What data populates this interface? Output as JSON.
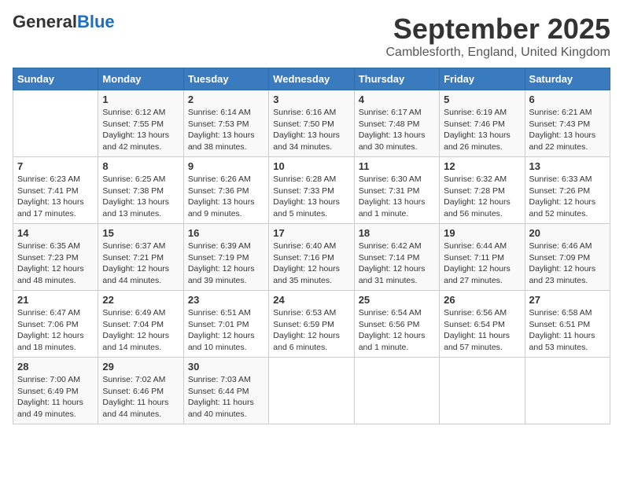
{
  "header": {
    "logo_line1": "General",
    "logo_line2": "Blue",
    "month": "September 2025",
    "location": "Camblesforth, England, United Kingdom"
  },
  "days_of_week": [
    "Sunday",
    "Monday",
    "Tuesday",
    "Wednesday",
    "Thursday",
    "Friday",
    "Saturday"
  ],
  "weeks": [
    [
      {
        "day": "",
        "info": ""
      },
      {
        "day": "1",
        "info": "Sunrise: 6:12 AM\nSunset: 7:55 PM\nDaylight: 13 hours\nand 42 minutes."
      },
      {
        "day": "2",
        "info": "Sunrise: 6:14 AM\nSunset: 7:53 PM\nDaylight: 13 hours\nand 38 minutes."
      },
      {
        "day": "3",
        "info": "Sunrise: 6:16 AM\nSunset: 7:50 PM\nDaylight: 13 hours\nand 34 minutes."
      },
      {
        "day": "4",
        "info": "Sunrise: 6:17 AM\nSunset: 7:48 PM\nDaylight: 13 hours\nand 30 minutes."
      },
      {
        "day": "5",
        "info": "Sunrise: 6:19 AM\nSunset: 7:46 PM\nDaylight: 13 hours\nand 26 minutes."
      },
      {
        "day": "6",
        "info": "Sunrise: 6:21 AM\nSunset: 7:43 PM\nDaylight: 13 hours\nand 22 minutes."
      }
    ],
    [
      {
        "day": "7",
        "info": "Sunrise: 6:23 AM\nSunset: 7:41 PM\nDaylight: 13 hours\nand 17 minutes."
      },
      {
        "day": "8",
        "info": "Sunrise: 6:25 AM\nSunset: 7:38 PM\nDaylight: 13 hours\nand 13 minutes."
      },
      {
        "day": "9",
        "info": "Sunrise: 6:26 AM\nSunset: 7:36 PM\nDaylight: 13 hours\nand 9 minutes."
      },
      {
        "day": "10",
        "info": "Sunrise: 6:28 AM\nSunset: 7:33 PM\nDaylight: 13 hours\nand 5 minutes."
      },
      {
        "day": "11",
        "info": "Sunrise: 6:30 AM\nSunset: 7:31 PM\nDaylight: 13 hours\nand 1 minute."
      },
      {
        "day": "12",
        "info": "Sunrise: 6:32 AM\nSunset: 7:28 PM\nDaylight: 12 hours\nand 56 minutes."
      },
      {
        "day": "13",
        "info": "Sunrise: 6:33 AM\nSunset: 7:26 PM\nDaylight: 12 hours\nand 52 minutes."
      }
    ],
    [
      {
        "day": "14",
        "info": "Sunrise: 6:35 AM\nSunset: 7:23 PM\nDaylight: 12 hours\nand 48 minutes."
      },
      {
        "day": "15",
        "info": "Sunrise: 6:37 AM\nSunset: 7:21 PM\nDaylight: 12 hours\nand 44 minutes."
      },
      {
        "day": "16",
        "info": "Sunrise: 6:39 AM\nSunset: 7:19 PM\nDaylight: 12 hours\nand 39 minutes."
      },
      {
        "day": "17",
        "info": "Sunrise: 6:40 AM\nSunset: 7:16 PM\nDaylight: 12 hours\nand 35 minutes."
      },
      {
        "day": "18",
        "info": "Sunrise: 6:42 AM\nSunset: 7:14 PM\nDaylight: 12 hours\nand 31 minutes."
      },
      {
        "day": "19",
        "info": "Sunrise: 6:44 AM\nSunset: 7:11 PM\nDaylight: 12 hours\nand 27 minutes."
      },
      {
        "day": "20",
        "info": "Sunrise: 6:46 AM\nSunset: 7:09 PM\nDaylight: 12 hours\nand 23 minutes."
      }
    ],
    [
      {
        "day": "21",
        "info": "Sunrise: 6:47 AM\nSunset: 7:06 PM\nDaylight: 12 hours\nand 18 minutes."
      },
      {
        "day": "22",
        "info": "Sunrise: 6:49 AM\nSunset: 7:04 PM\nDaylight: 12 hours\nand 14 minutes."
      },
      {
        "day": "23",
        "info": "Sunrise: 6:51 AM\nSunset: 7:01 PM\nDaylight: 12 hours\nand 10 minutes."
      },
      {
        "day": "24",
        "info": "Sunrise: 6:53 AM\nSunset: 6:59 PM\nDaylight: 12 hours\nand 6 minutes."
      },
      {
        "day": "25",
        "info": "Sunrise: 6:54 AM\nSunset: 6:56 PM\nDaylight: 12 hours\nand 1 minute."
      },
      {
        "day": "26",
        "info": "Sunrise: 6:56 AM\nSunset: 6:54 PM\nDaylight: 11 hours\nand 57 minutes."
      },
      {
        "day": "27",
        "info": "Sunrise: 6:58 AM\nSunset: 6:51 PM\nDaylight: 11 hours\nand 53 minutes."
      }
    ],
    [
      {
        "day": "28",
        "info": "Sunrise: 7:00 AM\nSunset: 6:49 PM\nDaylight: 11 hours\nand 49 minutes."
      },
      {
        "day": "29",
        "info": "Sunrise: 7:02 AM\nSunset: 6:46 PM\nDaylight: 11 hours\nand 44 minutes."
      },
      {
        "day": "30",
        "info": "Sunrise: 7:03 AM\nSunset: 6:44 PM\nDaylight: 11 hours\nand 40 minutes."
      },
      {
        "day": "",
        "info": ""
      },
      {
        "day": "",
        "info": ""
      },
      {
        "day": "",
        "info": ""
      },
      {
        "day": "",
        "info": ""
      }
    ]
  ]
}
